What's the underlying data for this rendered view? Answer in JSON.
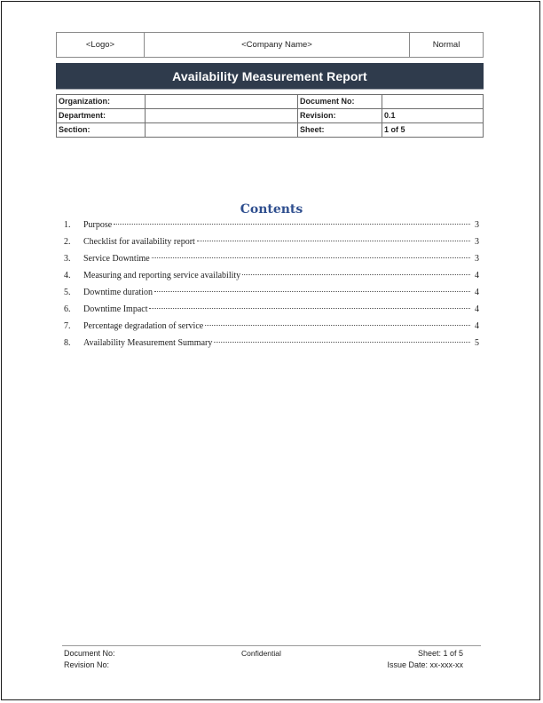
{
  "header": {
    "logo": "<Logo>",
    "company_name": "<Company Name>",
    "classification": "Normal"
  },
  "title": "Availability Measurement Report",
  "info_table": {
    "rows": [
      {
        "label1": "Organization:",
        "value1": "",
        "label2": "Document No:",
        "value2": ""
      },
      {
        "label1": "Department:",
        "value1": "",
        "label2": "Revision:",
        "value2": "0.1"
      },
      {
        "label1": "Section:",
        "value1": "",
        "label2": "Sheet:",
        "value2": "1 of 5"
      }
    ]
  },
  "contents": {
    "heading": "Contents",
    "items": [
      {
        "num": "1.",
        "text": "Purpose",
        "page": "3"
      },
      {
        "num": "2.",
        "text": "Checklist for availability report",
        "page": "3"
      },
      {
        "num": "3.",
        "text": "Service Downtime",
        "page": "3"
      },
      {
        "num": "4.",
        "text": "Measuring and reporting service availability",
        "page": "4"
      },
      {
        "num": "5.",
        "text": "Downtime duration",
        "page": "4"
      },
      {
        "num": "6.",
        "text": "Downtime Impact",
        "page": "4"
      },
      {
        "num": "7.",
        "text": "Percentage degradation of service",
        "page": "4"
      },
      {
        "num": "8.",
        "text": "Availability Measurement Summary",
        "page": "5"
      }
    ]
  },
  "footer": {
    "document_no": "Document No:",
    "revision_no": "Revision No:",
    "confidential": "Confidential",
    "sheet": "Sheet: 1 of 5",
    "issue_date": "Issue Date: xx-xxx-xx"
  },
  "colors": {
    "title_bar": "#2f3b4c",
    "contents_heading": "#2f4f8f"
  }
}
